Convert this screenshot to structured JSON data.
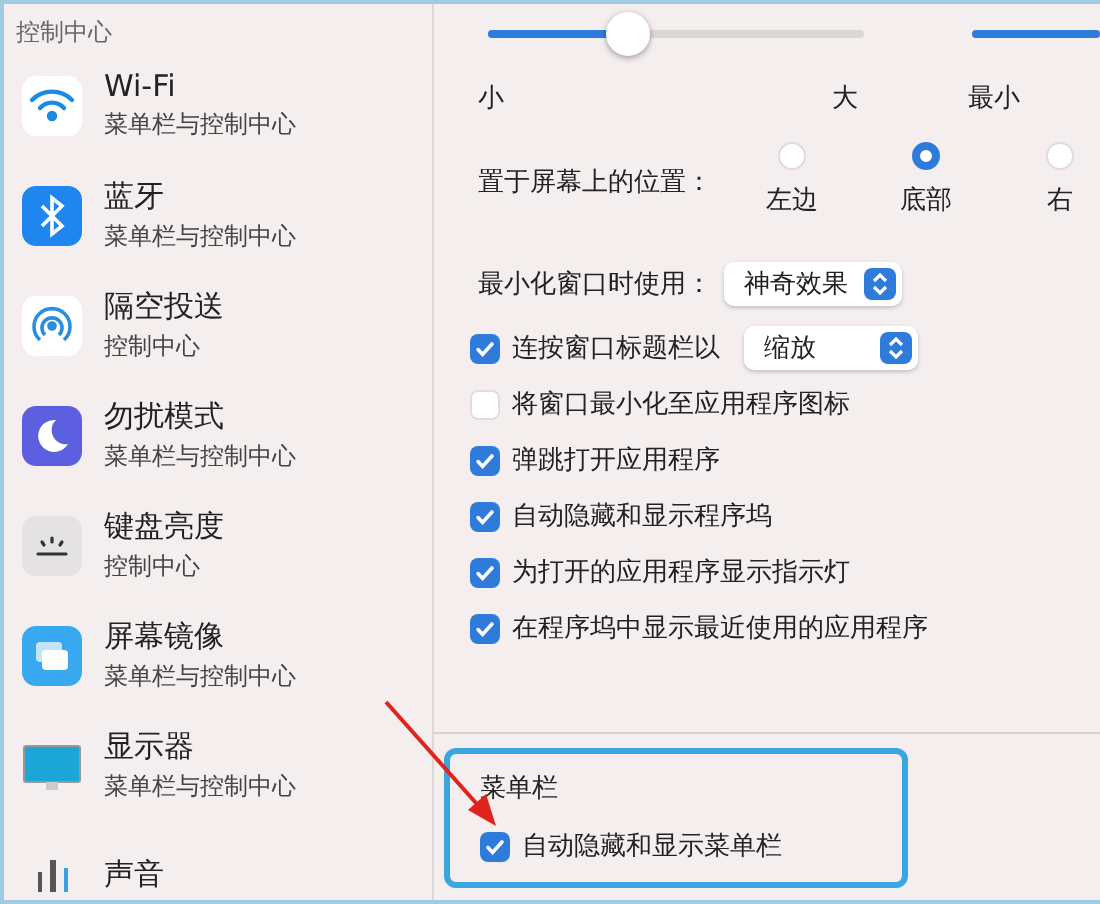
{
  "sidebar": {
    "header": "控制中心",
    "items": [
      {
        "kind": "wifi",
        "title": "Wi-Fi",
        "subtitle": "菜单栏与控制中心"
      },
      {
        "kind": "bluetooth",
        "title": "蓝牙",
        "subtitle": "菜单栏与控制中心"
      },
      {
        "kind": "airdrop",
        "title": "隔空投送",
        "subtitle": "控制中心"
      },
      {
        "kind": "focus",
        "title": "勿扰模式",
        "subtitle": "菜单栏与控制中心"
      },
      {
        "kind": "keyboard",
        "title": "键盘亮度",
        "subtitle": "控制中心"
      },
      {
        "kind": "mirroring",
        "title": "屏幕镜像",
        "subtitle": "菜单栏与控制中心"
      },
      {
        "kind": "display",
        "title": "显示器",
        "subtitle": "菜单栏与控制中心"
      },
      {
        "kind": "sound",
        "title": "声音"
      }
    ]
  },
  "dock": {
    "size_slider": {
      "level": 0.37,
      "min_label": "小",
      "max_label": "大"
    },
    "magnify_slider": {
      "level": 1
    },
    "magnify_label": "最小",
    "position": {
      "label": "置于屏幕上的位置：",
      "options": [
        {
          "label": "左边",
          "selected": false
        },
        {
          "label": "底部",
          "selected": true
        },
        {
          "label": "右",
          "selected": false
        }
      ]
    },
    "minimize": {
      "label": "最小化窗口时使用：",
      "value": "神奇效果"
    },
    "options": [
      {
        "label": "连按窗口标题栏以",
        "checked": true,
        "popup": "缩放"
      },
      {
        "label": "将窗口最小化至应用程序图标",
        "checked": false
      },
      {
        "label": "弹跳打开应用程序",
        "checked": true
      },
      {
        "label": "自动隐藏和显示程序坞",
        "checked": true
      },
      {
        "label": "为打开的应用程序显示指示灯",
        "checked": true
      },
      {
        "label": "在程序坞中显示最近使用的应用程序",
        "checked": true
      }
    ]
  },
  "menu_bar": {
    "title": "菜单栏",
    "options": [
      {
        "label": "自动隐藏和显示菜单栏",
        "checked": true
      }
    ]
  }
}
